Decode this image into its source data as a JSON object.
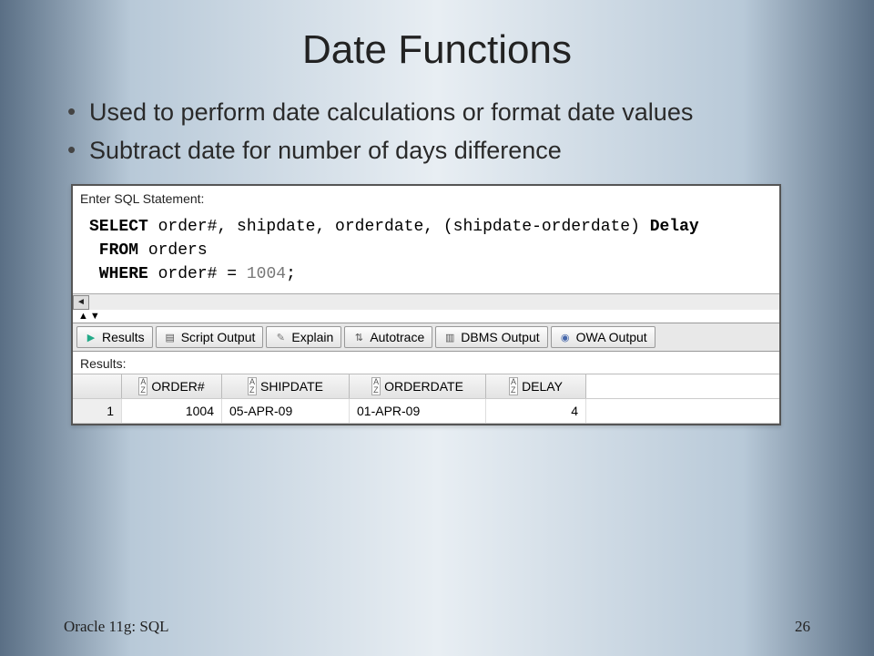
{
  "title": "Date Functions",
  "bullets": [
    "Used to perform date calculations or format date values",
    "Subtract date for number of days difference"
  ],
  "panel": {
    "prompt": "Enter SQL Statement:",
    "sql_line1_kw": "SELECT",
    "sql_line1_rest": " order#, shipdate, orderdate, (shipdate-orderdate) ",
    "sql_line1_alias": "Delay",
    "sql_line2_kw": " FROM",
    "sql_line2_rest": " orders",
    "sql_line3_kw": " WHERE",
    "sql_line3_rest": " order# = ",
    "sql_line3_lit": "1004",
    "sql_line3_end": ";"
  },
  "tabs": {
    "results": "Results",
    "script": "Script Output",
    "explain": "Explain",
    "autotrace": "Autotrace",
    "dbms": "DBMS Output",
    "owa": "OWA Output"
  },
  "results": {
    "label": "Results:",
    "columns": [
      "ORDER#",
      "SHIPDATE",
      "ORDERDATE",
      "DELAY"
    ],
    "rows": [
      {
        "n": "1",
        "order": "1004",
        "ship": "05-APR-09",
        "orderdate": "01-APR-09",
        "delay": "4"
      }
    ]
  },
  "footer": {
    "left": "Oracle 11g: SQL",
    "right": "26"
  }
}
